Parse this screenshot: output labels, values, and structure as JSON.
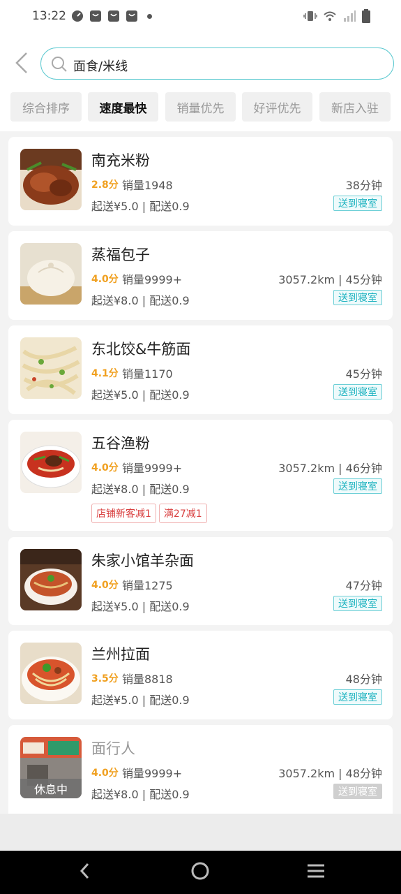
{
  "status_bar": {
    "time": "13:22"
  },
  "search": {
    "query": "面食/米线"
  },
  "filters": [
    {
      "label": "综合排序",
      "active": false
    },
    {
      "label": "速度最快",
      "active": true
    },
    {
      "label": "销量优先",
      "active": false
    },
    {
      "label": "好评优先",
      "active": false
    },
    {
      "label": "新店入驻",
      "active": false
    }
  ],
  "shops": [
    {
      "name": "南充米粉",
      "rating": "2.8分",
      "sales": "销量1948",
      "eta": "38分钟",
      "fees": "起送¥5.0 | 配送0.9",
      "tag": "送到寝室",
      "promos": []
    },
    {
      "name": "蒸福包子",
      "rating": "4.0分",
      "sales": "销量9999+",
      "eta": "3057.2km | 45分钟",
      "fees": "起送¥8.0 | 配送0.9",
      "tag": "送到寝室",
      "promos": []
    },
    {
      "name": "东北饺&牛筋面",
      "rating": "4.1分",
      "sales": "销量1170",
      "eta": "45分钟",
      "fees": "起送¥5.0 | 配送0.9",
      "tag": "送到寝室",
      "promos": []
    },
    {
      "name": "五谷渔粉",
      "rating": "4.0分",
      "sales": "销量9999+",
      "eta": "3057.2km | 46分钟",
      "fees": "起送¥8.0 | 配送0.9",
      "tag": "送到寝室",
      "promos": [
        "店铺新客减1",
        "满27减1"
      ]
    },
    {
      "name": "朱家小馆羊杂面",
      "rating": "4.0分",
      "sales": "销量1275",
      "eta": "47分钟",
      "fees": "起送¥5.0 | 配送0.9",
      "tag": "送到寝室",
      "promos": []
    },
    {
      "name": "兰州拉面",
      "rating": "3.5分",
      "sales": "销量8818",
      "eta": "48分钟",
      "fees": "起送¥5.0 | 配送0.9",
      "tag": "送到寝室",
      "promos": []
    },
    {
      "name": "面行人",
      "rating": "4.0分",
      "sales": "销量9999+",
      "eta": "3057.2km | 48分钟",
      "fees": "起送¥8.0 | 配送0.9",
      "tag": "送到寝室",
      "status": "休息中",
      "promos": []
    }
  ],
  "colors": {
    "accent": "#1eb3c0",
    "rating": "#f0a020",
    "promo": "#d94040"
  },
  "icons": {
    "back": "back-arrow-icon",
    "search": "search-icon",
    "nav_back": "nav-back-icon",
    "nav_home": "nav-home-icon",
    "nav_menu": "nav-menu-icon"
  }
}
